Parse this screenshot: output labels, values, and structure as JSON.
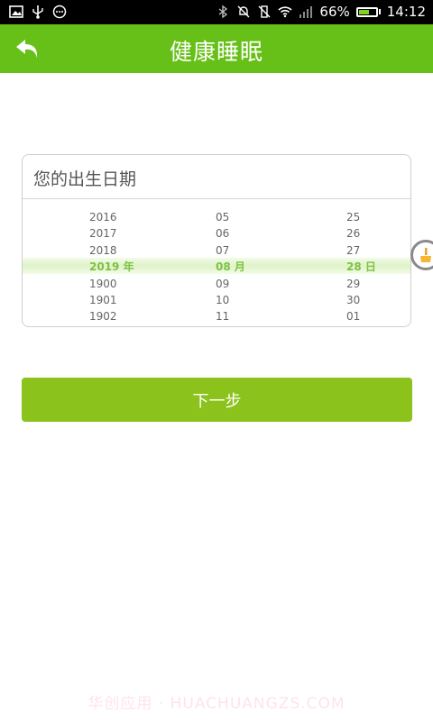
{
  "status_bar": {
    "battery_percent": "66%",
    "battery_level": 0.66,
    "time": "14:12",
    "left_icons": [
      "image-icon",
      "usb-icon",
      "chat-icon"
    ],
    "right_icons": [
      "bluetooth-icon",
      "mute-icon",
      "vibrate-off-icon",
      "wifi-icon",
      "signal-icon",
      "battery-icon"
    ]
  },
  "header": {
    "title": "健康睡眠",
    "back_icon": "back-arrow-icon",
    "color": "#66c018"
  },
  "birth_date": {
    "title": "您的出生日期",
    "years": [
      "2016",
      "2017",
      "2018",
      "2019 年",
      "1900",
      "1901",
      "1902"
    ],
    "months": [
      "05",
      "06",
      "07",
      "08 月",
      "09",
      "10",
      "11"
    ],
    "days": [
      "25",
      "26",
      "27",
      "28 日",
      "29",
      "30",
      "01"
    ],
    "selected_index": 3,
    "selected_color": "#7cc241"
  },
  "next_button": {
    "label": "下一步",
    "color": "#8cc21c"
  },
  "float_icon": "broom-icon",
  "watermark": "华创应用 · HUACHUANGZS.COM"
}
